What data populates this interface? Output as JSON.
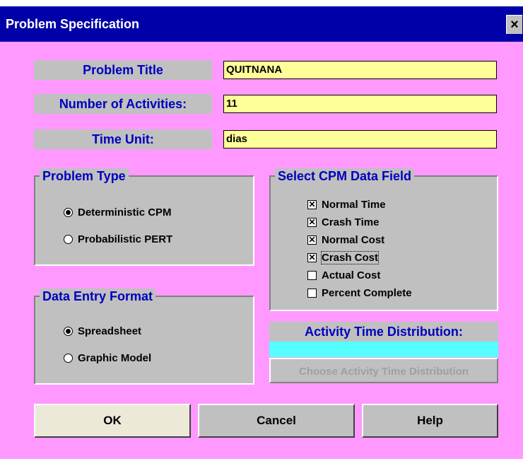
{
  "window": {
    "title": "Problem Specification",
    "close_glyph": "×"
  },
  "fields": {
    "problem_title": {
      "label": "Problem Title",
      "value": "QUITNANA"
    },
    "num_activities": {
      "label": "Number of Activities:",
      "value": "11"
    },
    "time_unit": {
      "label": "Time Unit:",
      "value": "dias"
    }
  },
  "problem_type": {
    "legend": "Problem Type",
    "options": [
      {
        "label": "Deterministic CPM",
        "selected": true
      },
      {
        "label": "Probabilistic PERT",
        "selected": false
      }
    ]
  },
  "data_entry": {
    "legend": "Data Entry Format",
    "options": [
      {
        "label": "Spreadsheet",
        "selected": true
      },
      {
        "label": "Graphic Model",
        "selected": false
      }
    ]
  },
  "cpm_fields": {
    "legend": "Select CPM Data Field",
    "options": [
      {
        "label": "Normal Time",
        "checked": true
      },
      {
        "label": "Crash Time",
        "checked": true
      },
      {
        "label": "Normal Cost",
        "checked": true
      },
      {
        "label": "Crash Cost",
        "checked": true
      },
      {
        "label": "Actual Cost",
        "checked": false
      },
      {
        "label": "Percent Complete",
        "checked": false
      }
    ],
    "check_glyph": "✕"
  },
  "activity_time": {
    "label": "Activity Time Distribution:",
    "value": "",
    "button": "Choose Activity Time Distribution"
  },
  "buttons": {
    "ok": "OK",
    "cancel": "Cancel",
    "help": "Help"
  }
}
